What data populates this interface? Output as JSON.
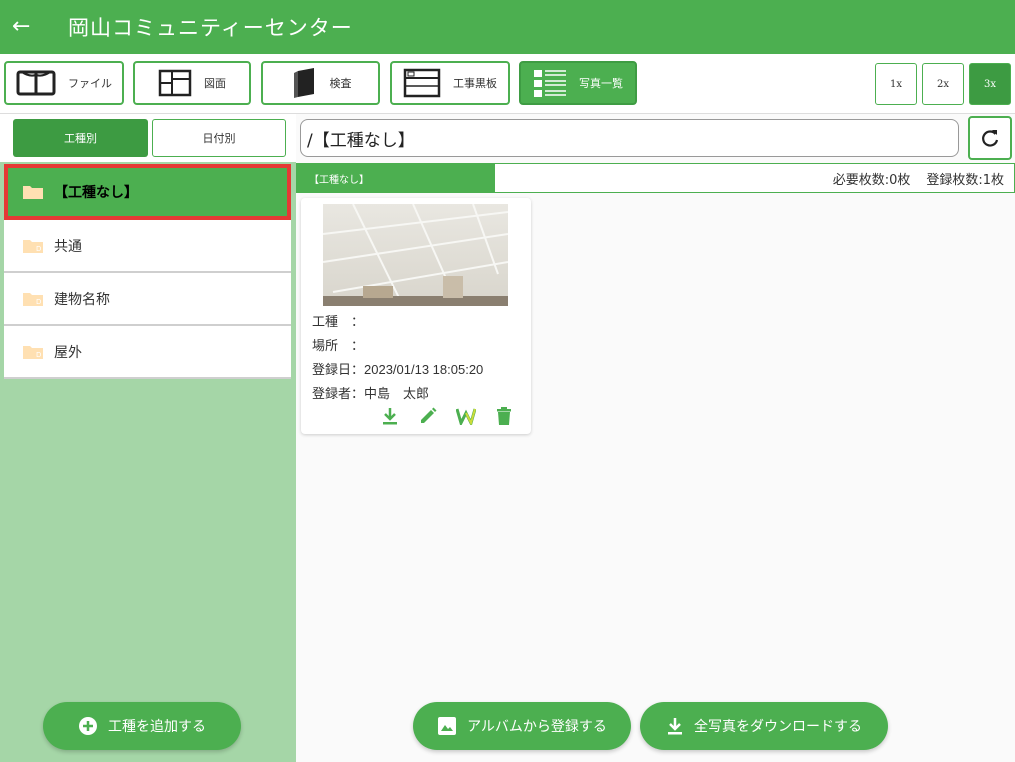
{
  "header": {
    "title": "岡山コミュニティーセンター",
    "back_icon": "arrow-left-icon"
  },
  "toolbar": {
    "file_label": "ファイル",
    "drawing_label": "図面",
    "inspection_label": "検査",
    "blackboard_label": "工事黒板",
    "photolist_label": "写真一覧",
    "zoom": [
      "1x",
      "2x",
      "3x"
    ]
  },
  "sidebar": {
    "tab_trade": "工種別",
    "tab_date": "日付別",
    "folders": [
      "【工種なし】",
      "共通",
      "建物名称",
      "屋外"
    ],
    "add_button": "工種を追加する"
  },
  "main": {
    "path": "/【工種なし】",
    "info": {
      "tag": "【工種なし】",
      "required": "必要枚数:0枚",
      "registered": "登録枚数:1枚"
    },
    "photo": {
      "trade_label": "工種　：",
      "location_label": "場所　：",
      "date_label": "登録日：2023/01/13 18:05:20",
      "author_label": "登録者：中島　太郎"
    },
    "album_button": "アルバムから登録する",
    "download_all_button": "全写真をダウンロードする"
  },
  "colors": {
    "primary": "#4caf50",
    "primary_dark": "#3d9b42",
    "sidebar_bg": "#a5d6a7",
    "highlight": "#e53935"
  }
}
